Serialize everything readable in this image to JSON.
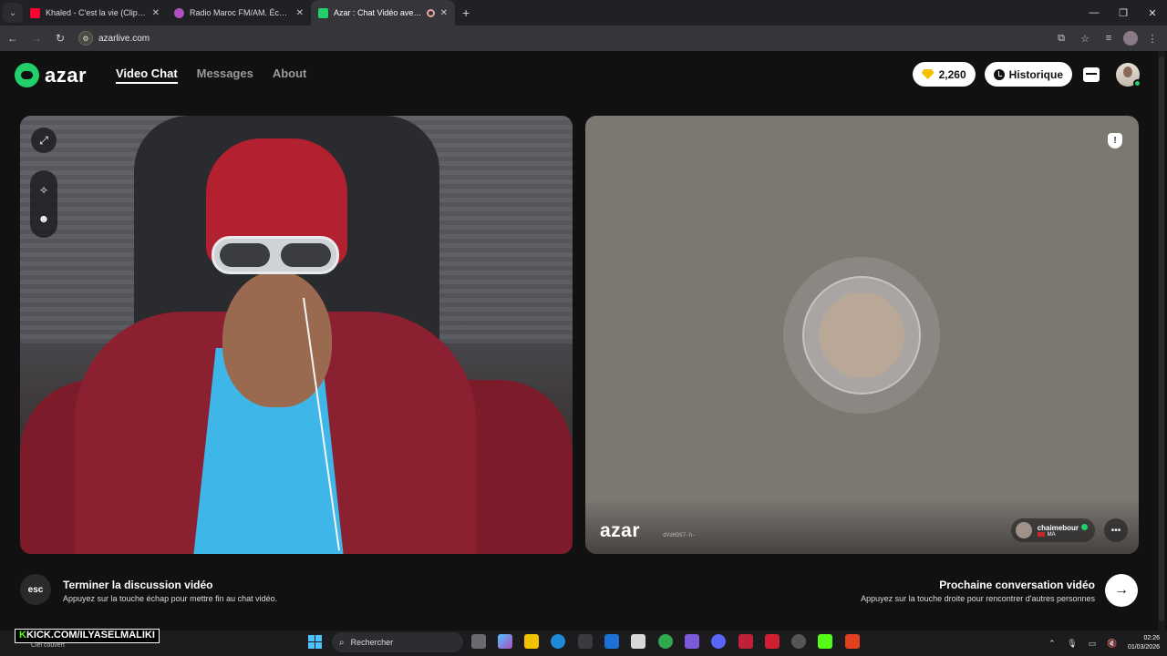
{
  "browser": {
    "tabs": [
      {
        "title": "Khaled - C'est la vie (Clip officie",
        "favicon_color": "#ff0033"
      },
      {
        "title": "Radio Maroc FM/AM. Écouter r",
        "favicon_color": "#b04fc0"
      },
      {
        "title": "Azar : Chat Vidéo avec de n",
        "favicon_color": "#22d06b",
        "active": true
      }
    ],
    "new_tab": "+",
    "url": "azarlive.com"
  },
  "header": {
    "logo": "azar",
    "nav": [
      {
        "label": "Video Chat",
        "active": true
      },
      {
        "label": "Messages",
        "active": false
      },
      {
        "label": "About",
        "active": false
      }
    ],
    "gems": "2,260",
    "history_label": "Historique"
  },
  "remote": {
    "watermark": "azar",
    "watermark_id": "dVdHDS7-h-",
    "partner_name": "chaimebour",
    "partner_country": "MA"
  },
  "controls": {
    "esc_key": "esc",
    "end_title": "Terminer la discussion vidéo",
    "end_hint": "Appuyez sur la touche échap pour mettre fin au chat vidéo.",
    "next_title": "Prochaine conversation vidéo",
    "next_hint": "Appuyez sur la touche droite pour rencontrer d'autres personnes"
  },
  "taskbar": {
    "overlay_text": "KICK.COM/ILYASELMALIKI",
    "weather": "Ciel couvert",
    "search_label": "Rechercher",
    "time": "02:26",
    "date": "01/03/2026"
  },
  "colors": {
    "brand": "#22d06b",
    "gem": "#f2c200"
  }
}
